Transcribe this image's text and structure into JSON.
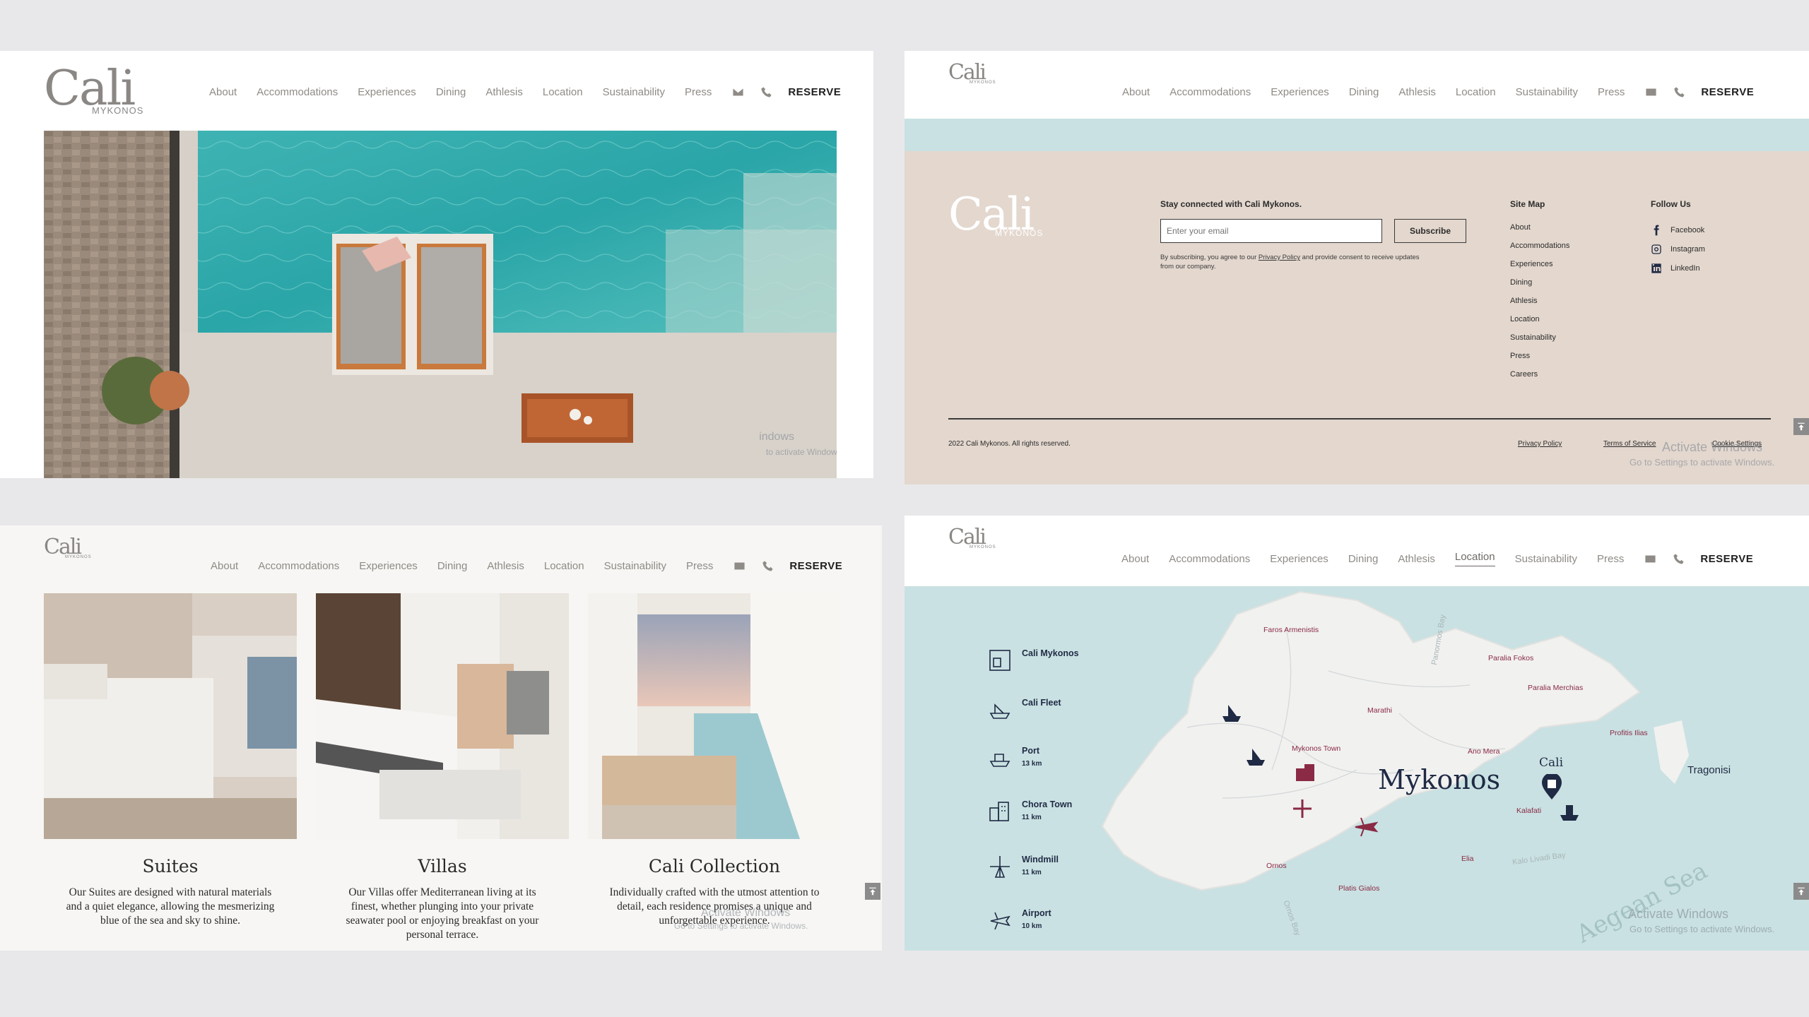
{
  "nav": {
    "items": [
      "About",
      "Accommodations",
      "Experiences",
      "Dining",
      "Athlesis",
      "Location",
      "Sustainability",
      "Press"
    ],
    "active_location": "Location",
    "reserve": "RESERVE"
  },
  "logo": {
    "word": "Cali",
    "sub": "MYKONOS"
  },
  "watermark": {
    "line1": "Activate Windows",
    "line2": "Go to Settings to activate Windows.",
    "partial1": "indows",
    "partial2": "to activate Windows."
  },
  "footer": {
    "stay_connected": "Stay connected with Cali Mykonos.",
    "email_placeholder": "Enter your email",
    "subscribe": "Subscribe",
    "legal_pre": "By subscribing, you agree to our ",
    "legal_link": "Privacy Policy",
    "legal_post": " and provide consent to receive updates from our company.",
    "sitemap_title": "Site Map",
    "sitemap": [
      "About",
      "Accommodations",
      "Experiences",
      "Dining",
      "Athlesis",
      "Location",
      "Sustainability",
      "Press",
      "Careers"
    ],
    "follow_title": "Follow Us",
    "social": [
      "Facebook",
      "Instagram",
      "LinkedIn"
    ],
    "copyright": "2022 Cali Mykonos. All rights reserved.",
    "privacy": "Privacy Policy",
    "terms": "Terms of Service",
    "cookies": "Cookie Settings"
  },
  "rooms": [
    {
      "title": "Suites",
      "text": "Our Suites are designed with natural materials and a quiet elegance, allowing the mesmerizing blue of the sea and sky to shine."
    },
    {
      "title": "Villas",
      "text": "Our Villas offer Mediterranean living at its finest, whether plunging into your private seawater pool or enjoying breakfast on your personal terrace."
    },
    {
      "title": "Cali Collection",
      "text": "Individually crafted with the utmost attention to detail, each residence promises a unique and unforgettable experience."
    }
  ],
  "map": {
    "legend": [
      {
        "title": "Cali Mykonos",
        "sub": "",
        "icon": "hotel-icon"
      },
      {
        "title": "Cali Fleet",
        "sub": "",
        "icon": "yacht-icon"
      },
      {
        "title": "Port",
        "sub": "13 km",
        "icon": "ship-icon"
      },
      {
        "title": "Chora Town",
        "sub": "11 km",
        "icon": "town-icon"
      },
      {
        "title": "Windmill",
        "sub": "11 km",
        "icon": "windmill-icon"
      },
      {
        "title": "Airport",
        "sub": "10 km",
        "icon": "airplane-icon"
      }
    ],
    "island": "Mykonos",
    "places": {
      "faros": "Faros Armenistis",
      "paralia_fokos": "Paralia Fokos",
      "paralia_merchias": "Paralia Merchias",
      "marathi": "Marathi",
      "mykonos_town": "Mykonos Town",
      "ano_mera": "Ano Mera",
      "profitis": "Profitis Ilias",
      "kalafati": "Kalafati",
      "ornos": "Ornos",
      "elia": "Elia",
      "platis": "Platis Gialos"
    },
    "bays": {
      "panormos": "Panormos Bay",
      "kalo": "Kalo Livadi Bay",
      "ornos_bay": "Ornos Bay"
    },
    "tragonisi": "Tragonisi",
    "aegean": "Aegean Sea",
    "cali_marker": "Cali"
  },
  "colors": {
    "accent": "#1f2a44",
    "place": "#8a2a45",
    "sea": "#c9e1e2",
    "footer": "#e3d7ce"
  }
}
